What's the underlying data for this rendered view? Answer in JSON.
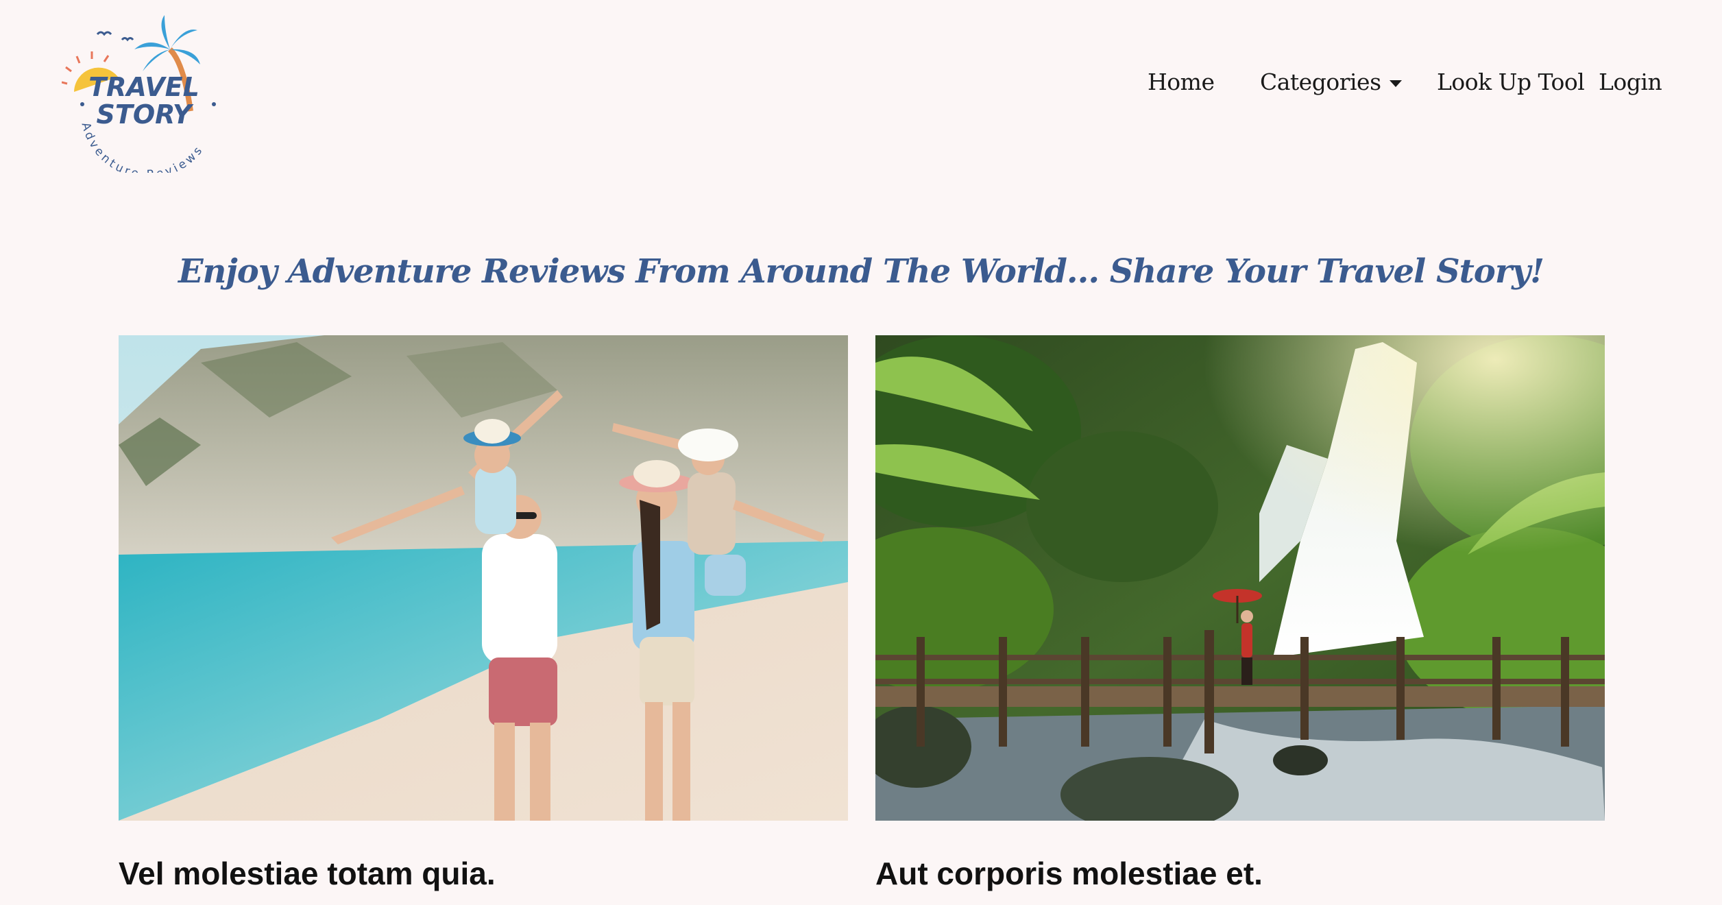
{
  "brand": {
    "logo_line1": "TRAVEL",
    "logo_line2": "STORY",
    "logo_ring": "Adventure Reviews",
    "accent_color": "#3b5b8f"
  },
  "nav": {
    "home": "Home",
    "categories": "Categories",
    "look_up_tool": "Look Up Tool",
    "login": "Login"
  },
  "tagline": "Enjoy Adventure Reviews From Around The World... Share Your Travel Story!",
  "cards": [
    {
      "title": "Vel molestiae totam quia.",
      "image": "beach-family-photo"
    },
    {
      "title": "Aut corporis molestiae et.",
      "image": "waterfall-bridge-photo"
    }
  ]
}
